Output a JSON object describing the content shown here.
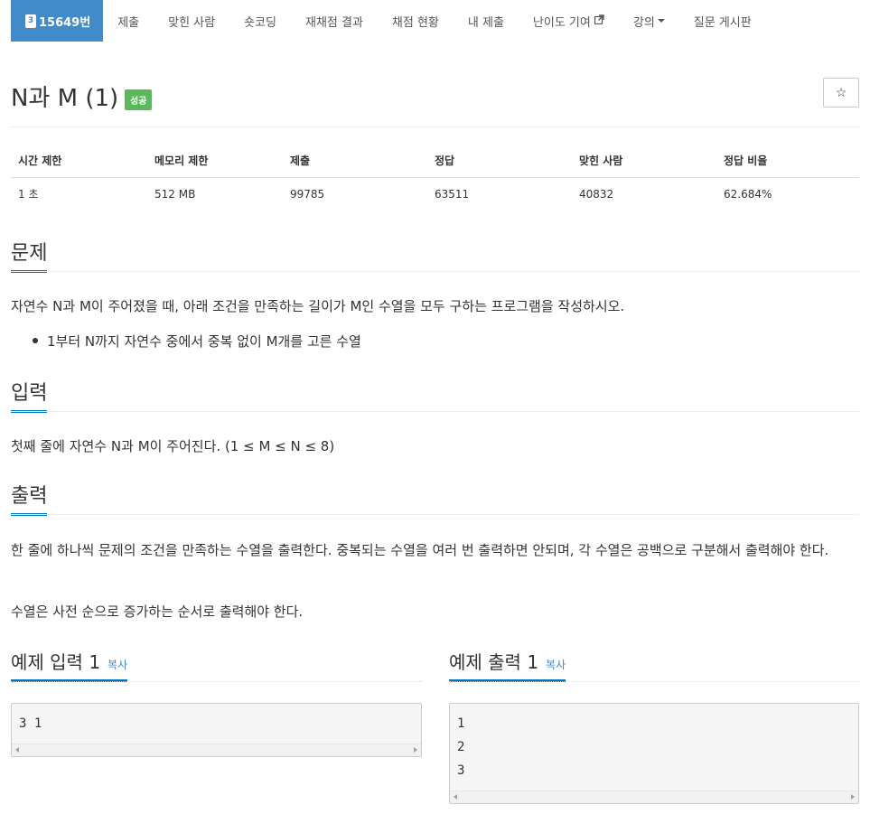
{
  "nav": {
    "problem_number": "15649번",
    "problem_badge": "3",
    "items": [
      "제출",
      "맞힌 사람",
      "숏코딩",
      "재채점 결과",
      "채점 현황",
      "내 제출",
      "난이도 기여",
      "강의",
      "질문 게시판"
    ]
  },
  "title": {
    "text": "N과 M (1)",
    "status": "성공",
    "star": "☆"
  },
  "info": {
    "headers": [
      "시간 제한",
      "메모리 제한",
      "제출",
      "정답",
      "맞힌 사람",
      "정답 비율"
    ],
    "values": [
      "1 초",
      "512 MB",
      "99785",
      "63511",
      "40832",
      "62.684%"
    ]
  },
  "problem": {
    "heading": "문제",
    "text": "자연수 N과 M이 주어졌을 때, 아래 조건을 만족하는 길이가 M인 수열을 모두 구하는 프로그램을 작성하시오.",
    "bullet": "1부터 N까지 자연수 중에서 중복 없이 M개를 고른 수열"
  },
  "input": {
    "heading": "입력",
    "text": "첫째 줄에 자연수 N과 M이 주어진다. (1 ≤ M ≤ N ≤ 8)"
  },
  "output": {
    "heading": "출력",
    "text1": "한 줄에 하나씩 문제의 조건을 만족하는 수열을 출력한다. 중복되는 수열을 여러 번 출력하면 안되며, 각 수열은 공백으로 구분해서 출력해야 한다.",
    "text2": "수열은 사전 순으로 증가하는 순서로 출력해야 한다."
  },
  "samples": {
    "input_heading": "예제 입력 1",
    "output_heading": "예제 출력 1",
    "copy_label": "복사",
    "input_lines": [
      "3 1"
    ],
    "output_lines": [
      "1",
      "2",
      "3"
    ]
  }
}
